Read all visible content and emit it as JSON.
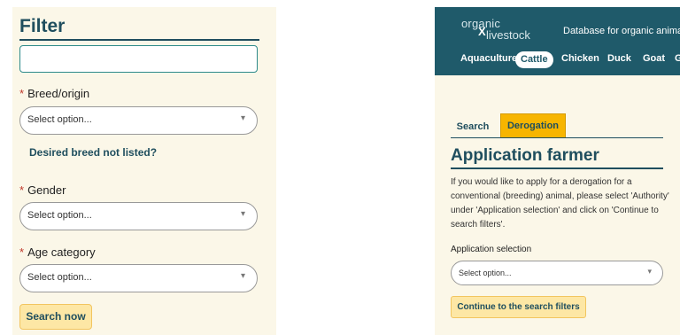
{
  "filter_panel": {
    "title": "Filter",
    "search_value": "",
    "required_mark": "*",
    "breed_label": "Breed/origin",
    "breed_placeholder": "Select option...",
    "breed_link": "Desired breed not listed?",
    "gender_label": "Gender",
    "gender_placeholder": "Select option...",
    "age_label": "Age category",
    "age_placeholder": "Select option...",
    "search_button": "Search now"
  },
  "right_panel": {
    "logo": {
      "line1": "organic",
      "x": "X",
      "line2": "livestock"
    },
    "tagline": "Database for organic animals -",
    "categories": [
      "Aquaculture",
      "Cattle",
      "Chicken",
      "Duck",
      "Goat",
      "G"
    ],
    "active_category": "Cattle",
    "tabs": {
      "search": "Search",
      "derogation": "Derogation"
    },
    "heading": "Application farmer",
    "info_text": "If you would like to apply for a derogation for a conventional (breeding) animal, please select 'Authority' under 'Application selection' and click on 'Continue to search filters'.",
    "selection_label": "Application selection",
    "selection_placeholder": "Select option...",
    "continue_button": "Continue to the search filters"
  },
  "colors": {
    "panel_bg": "#fbf7e8",
    "primary": "#1f4e5e",
    "header_bg": "#1f5a6a",
    "accent_tab": "#f7b500",
    "button_bg": "#fde7a5",
    "required": "#c0392b"
  },
  "icons": {
    "select_caret": "chevron-down-icon"
  }
}
